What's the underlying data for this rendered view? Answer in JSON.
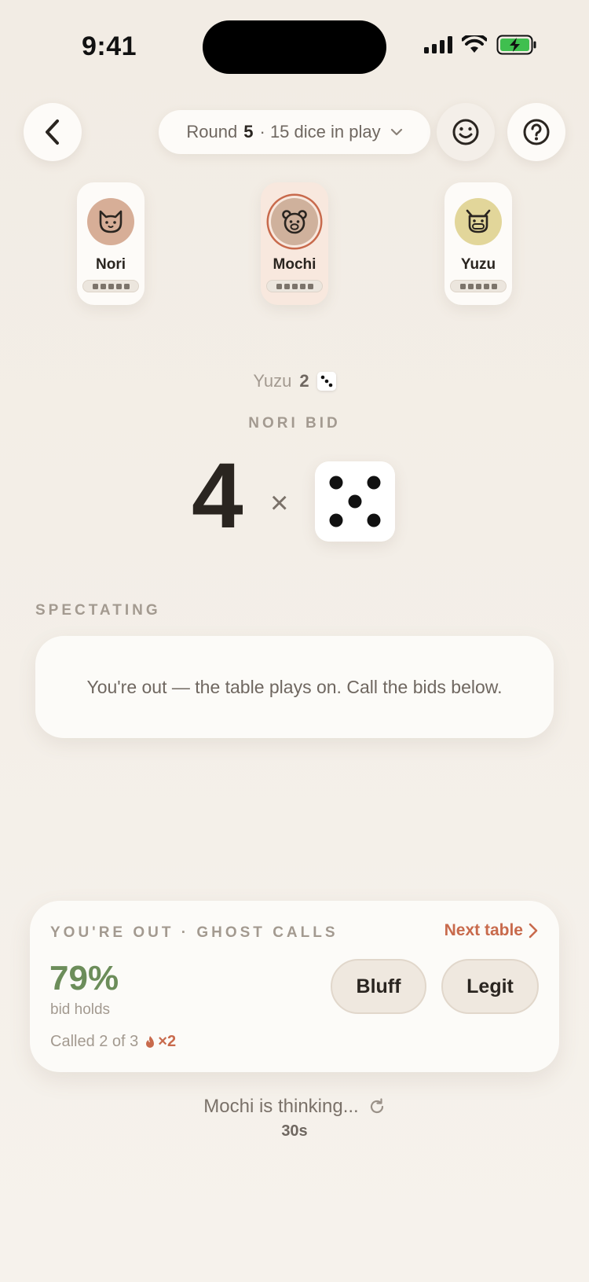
{
  "status_bar": {
    "time": "9:41"
  },
  "header": {
    "round_label": "Round",
    "round_number": "5",
    "dice_text": "· 15 dice in play"
  },
  "players": [
    {
      "name": "Nori",
      "avatar": "cat-icon",
      "avatar_color": "#d7ae97",
      "active": false
    },
    {
      "name": "Mochi",
      "avatar": "bear-icon",
      "avatar_color": "#cfb19c",
      "active": true
    },
    {
      "name": "Yuzu",
      "avatar": "ox-icon",
      "avatar_color": "#e2d69a",
      "active": false
    }
  ],
  "last_bid": {
    "player": "Yuzu",
    "quantity": "2",
    "face": 3
  },
  "current_bid": {
    "label": "NORI BID",
    "quantity": "4",
    "times": "×",
    "face": 5
  },
  "spectating": {
    "label": "SPECTATING",
    "message": "You're out — the table plays on. Call the bids below."
  },
  "ghost": {
    "title": "YOU'RE OUT · GHOST CALLS",
    "next_label": "Next table",
    "percent": "79%",
    "percent_sub": "bid holds",
    "called_text": "Called 2 of 3",
    "streak": "×2",
    "bluff_label": "Bluff",
    "legit_label": "Legit"
  },
  "thinking": {
    "text": "Mochi is thinking...",
    "timer": "30s"
  },
  "colors": {
    "accent": "#c86a4c",
    "positive": "#6c8d5a",
    "background": "#f3eee7"
  }
}
